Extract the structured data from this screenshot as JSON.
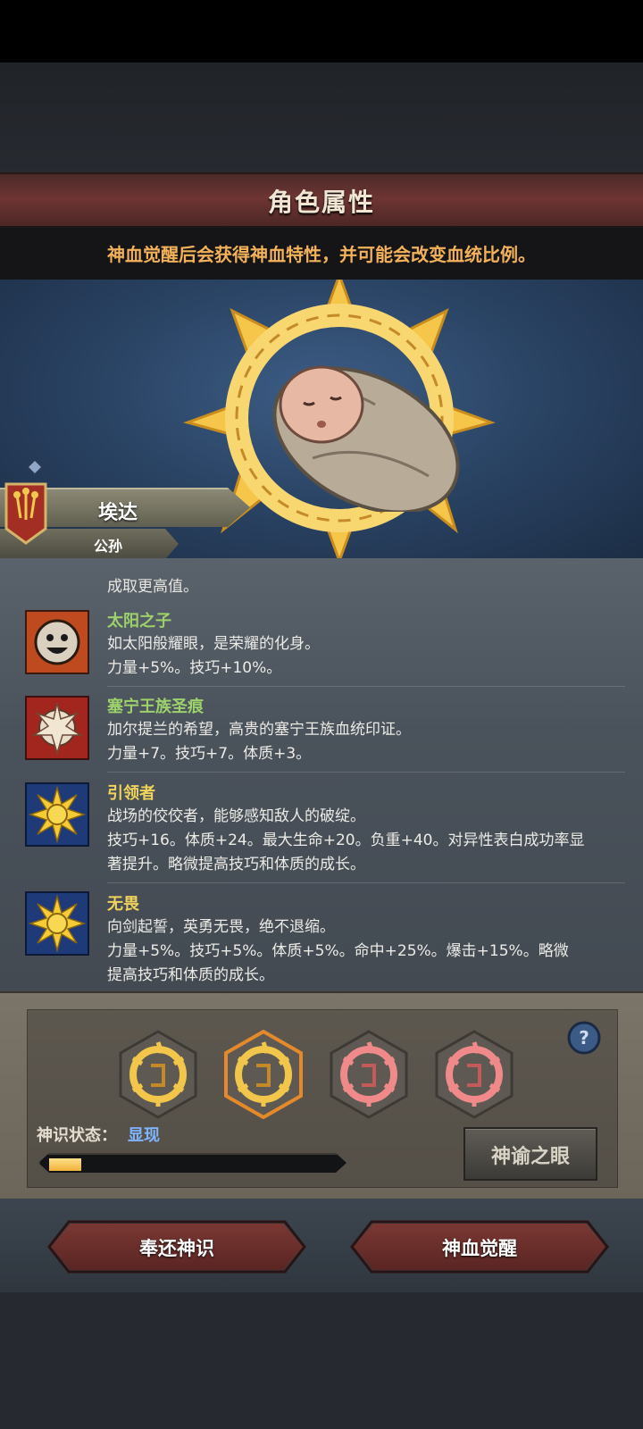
{
  "header": {
    "title": "角色属性",
    "hint": "神血觉醒后会获得神血特性，并可能会改变血统比例。"
  },
  "character": {
    "name": "埃达",
    "surname": "公孙"
  },
  "traits": {
    "cut_text": "成取更高值。",
    "items": [
      {
        "name": "太阳之子",
        "lines": [
          "如太阳般耀眼，是荣耀的化身。",
          "力量+5%。技巧+10%。"
        ]
      },
      {
        "name": "塞宁王族圣痕",
        "lines": [
          "加尔提兰的希望，高贵的塞宁王族血统印证。",
          "力量+7。技巧+7。体质+3。"
        ]
      },
      {
        "name": "引领者",
        "lines": [
          "战场的佼佼者，能够感知敌人的破绽。",
          "技巧+16。体质+24。最大生命+20。负重+40。对异性表白成功率显",
          "著提升。略微提高技巧和体质的成长。"
        ]
      },
      {
        "name": "无畏",
        "lines": [
          "向剑起誓，英勇无畏，绝不退缩。",
          "力量+5%。技巧+5%。体质+5%。命中+25%。爆击+15%。略微",
          "提高技巧和体质的成长。"
        ]
      }
    ]
  },
  "awaken": {
    "status_label": "神识状态：",
    "status_value": "显现",
    "progress": 0.11,
    "oracle_button": "神谕之眼",
    "help_label": "?"
  },
  "footer": {
    "return_button": "奉还神识",
    "awaken_button": "神血觉醒"
  },
  "colors": {
    "title_red": "#6e3533",
    "hint_orange": "#f3b25a",
    "trait_green": "#9dd16b",
    "trait_yellow": "#f0d35a",
    "status_blue": "#7fb4ff"
  }
}
